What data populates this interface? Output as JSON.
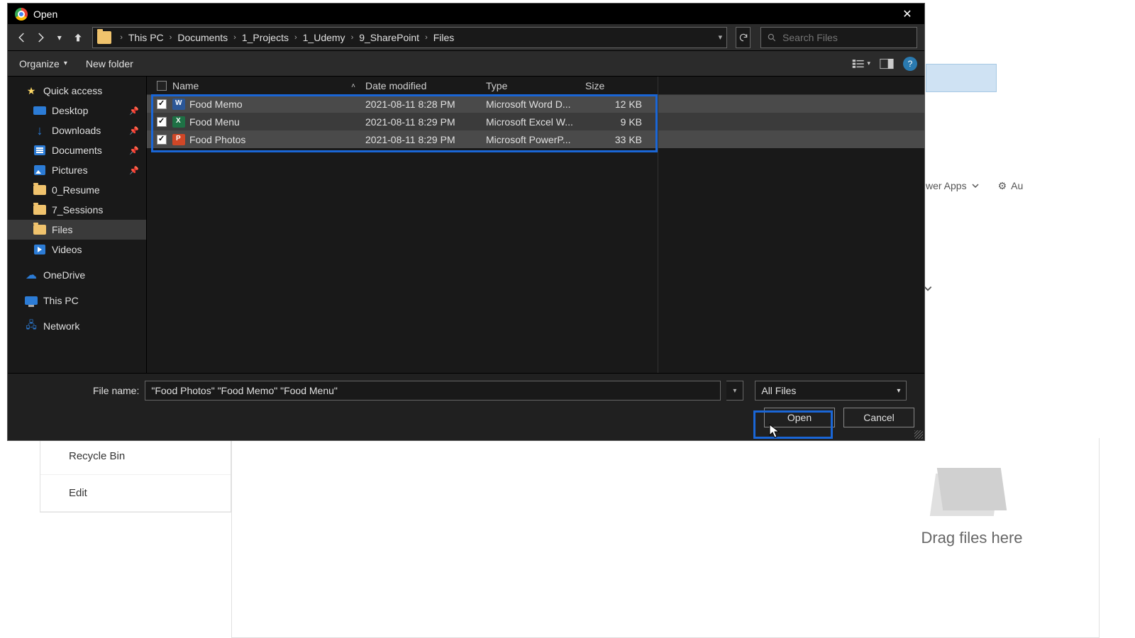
{
  "dialog": {
    "title": "Open",
    "close_tooltip": "Close"
  },
  "nav_buttons": {
    "back": "←",
    "forward": "→",
    "up": "↑"
  },
  "breadcrumb": {
    "items": [
      "This PC",
      "Documents",
      "1_Projects",
      "1_Udemy",
      "9_SharePoint",
      "Files"
    ]
  },
  "search": {
    "placeholder": "Search Files"
  },
  "toolbar": {
    "organize": "Organize",
    "new_folder": "New folder"
  },
  "sidebar": {
    "quick_access": "Quick access",
    "items": [
      {
        "label": "Desktop",
        "icon": "desktop",
        "pinned": true
      },
      {
        "label": "Downloads",
        "icon": "downloads",
        "pinned": true
      },
      {
        "label": "Documents",
        "icon": "documents",
        "pinned": true
      },
      {
        "label": "Pictures",
        "icon": "pictures",
        "pinned": true
      },
      {
        "label": "0_Resume",
        "icon": "folder",
        "pinned": false
      },
      {
        "label": "7_Sessions",
        "icon": "folder",
        "pinned": false
      },
      {
        "label": "Files",
        "icon": "folder",
        "pinned": false,
        "selected": true
      },
      {
        "label": "Videos",
        "icon": "videos",
        "pinned": false
      }
    ],
    "onedrive": "OneDrive",
    "this_pc": "This PC",
    "network": "Network"
  },
  "columns": {
    "name": "Name",
    "date": "Date modified",
    "type": "Type",
    "size": "Size"
  },
  "files": [
    {
      "name": "Food Memo",
      "date": "2021-08-11 8:28 PM",
      "type": "Microsoft Word D...",
      "size": "12 KB",
      "icon": "word",
      "selected": true
    },
    {
      "name": "Food Menu",
      "date": "2021-08-11 8:29 PM",
      "type": "Microsoft Excel W...",
      "size": "9 KB",
      "icon": "excel",
      "selected": true
    },
    {
      "name": "Food Photos",
      "date": "2021-08-11 8:29 PM",
      "type": "Microsoft PowerP...",
      "size": "33 KB",
      "icon": "ppt",
      "selected": true
    }
  ],
  "footer": {
    "filename_label": "File name:",
    "filename_value": "\"Food Photos\" \"Food Memo\" \"Food Menu\"",
    "filter": "All Files",
    "open": "Open",
    "cancel": "Cancel"
  },
  "backdrop": {
    "recycle": "Recycle Bin",
    "edit": "Edit",
    "apps": "wer Apps",
    "auto": "Au",
    "drag": "Drag files here"
  }
}
